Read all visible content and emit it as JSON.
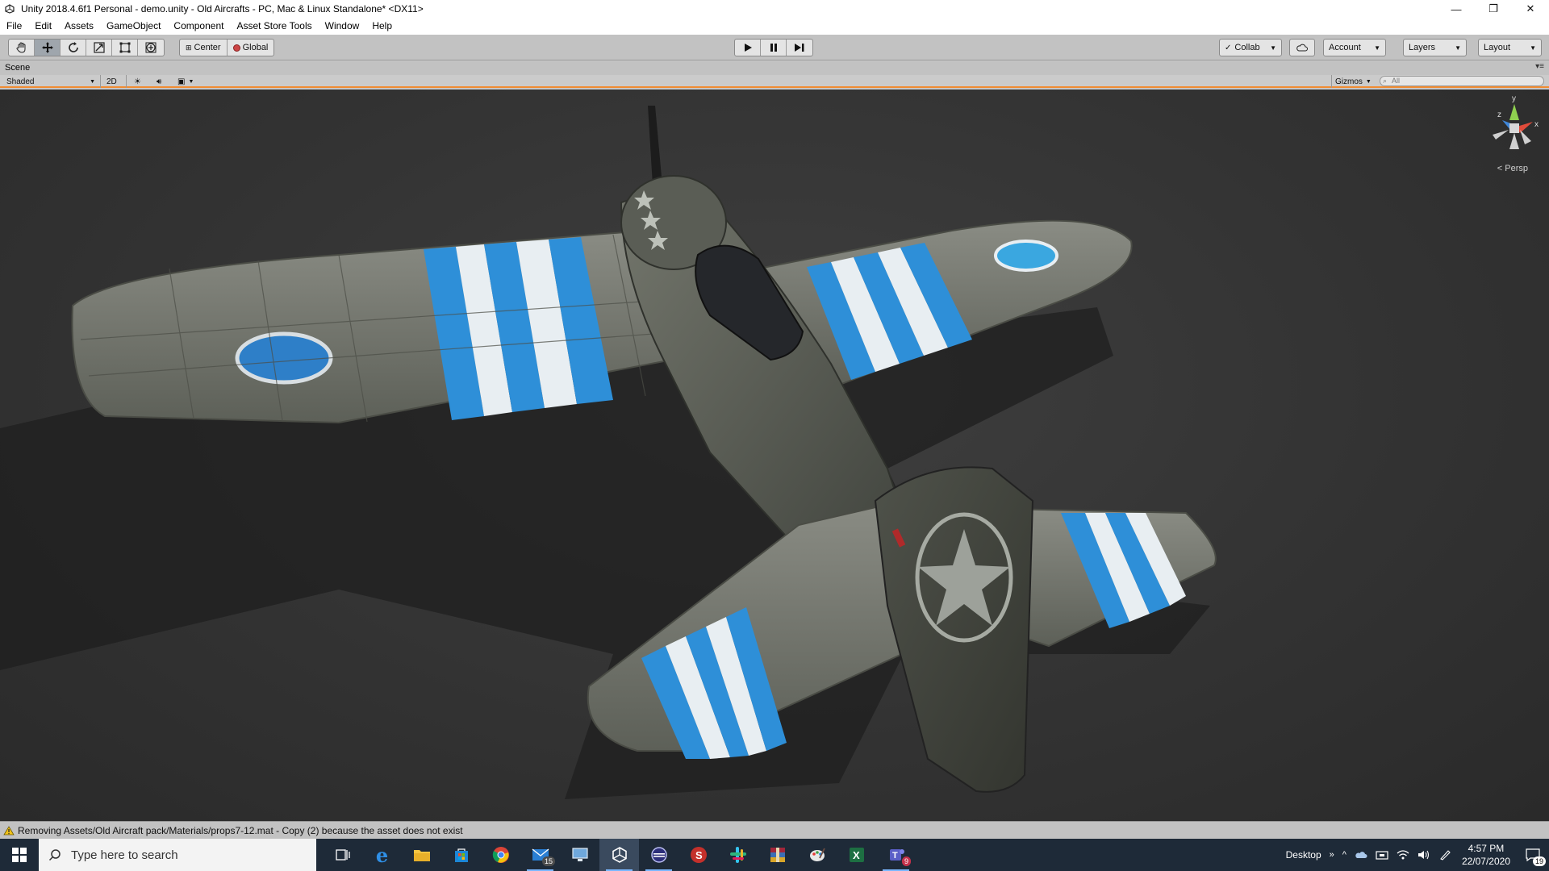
{
  "window": {
    "title": "Unity 2018.4.6f1 Personal - demo.unity - Old Aircrafts - PC, Mac & Linux Standalone* <DX11>",
    "minimize_glyph": "—",
    "restore_glyph": "❐",
    "close_glyph": "✕"
  },
  "menu": [
    "File",
    "Edit",
    "Assets",
    "GameObject",
    "Component",
    "Asset Store Tools",
    "Window",
    "Help"
  ],
  "toolbar": {
    "transform_tools": [
      "hand-tool-icon",
      "move-tool-icon",
      "rotate-tool-icon",
      "scale-tool-icon",
      "rect-tool-icon",
      "transform-tool-icon"
    ],
    "pivot_label": "Center",
    "rotation_label": "Global",
    "collab_label": "Collab",
    "account_label": "Account",
    "layers_label": "Layers",
    "layout_label": "Layout"
  },
  "scene": {
    "tab_label": "Scene",
    "draw_mode": "Shaded",
    "mode_2d": "2D",
    "gizmos_label": "Gizmos",
    "search_placeholder": "All",
    "projection_label": "< Persp",
    "gizmo_axes": {
      "x": "x",
      "y": "y",
      "z": "z"
    }
  },
  "status": {
    "message": "Removing Assets/Old Aircraft pack/Materials/props7-12.mat - Copy (2) because the asset does not exist"
  },
  "taskbar": {
    "search_placeholder": "Type here to search",
    "mail_badge": "15",
    "teams_badge": "9",
    "desktop_label": "Desktop",
    "chevron": "»",
    "time": "4:57 PM",
    "date": "22/07/2020",
    "notification_count": "19"
  },
  "colors": {
    "accent_orange": "#f08c32",
    "taskbar_bg": "#1e2a38",
    "stripe_blue": "#2e8fd8",
    "aircraft_gray": "#6b6e66"
  }
}
